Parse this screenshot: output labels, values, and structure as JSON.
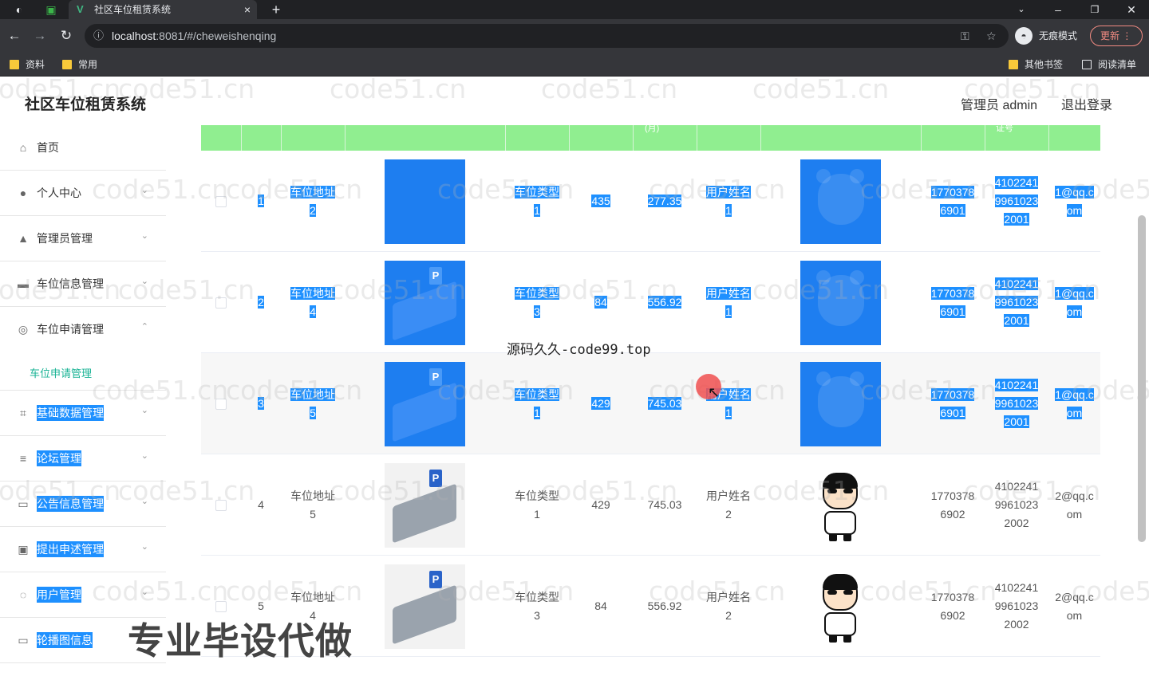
{
  "browser": {
    "tab_title": "社区车位租赁系统",
    "tab_logo": "V",
    "tab_close": "×",
    "new_tab": "+",
    "url_host": "localhost",
    "url_path": ":8081/#/cheweishenqing",
    "incognito_label": "无痕模式",
    "update_label": "更新",
    "bookmarks_left": [
      "资料",
      "常用"
    ],
    "bookmarks_right": [
      "其他书签",
      "阅读清单"
    ]
  },
  "header": {
    "title": "社区车位租赁系统",
    "admin": "管理员 admin",
    "logout": "退出登录"
  },
  "sidebar": {
    "items": [
      {
        "label": "首页",
        "icon": "home-icon",
        "glyph": "⌂",
        "arrow": ""
      },
      {
        "label": "个人中心",
        "icon": "user-icon",
        "glyph": "●",
        "arrow": "⌄"
      },
      {
        "label": "管理员管理",
        "icon": "admin-icon",
        "glyph": "▲",
        "arrow": "⌄"
      },
      {
        "label": "车位信息管理",
        "icon": "monitor-icon",
        "glyph": "▬",
        "arrow": "⌄"
      },
      {
        "label": "车位申请管理",
        "icon": "compass-icon",
        "glyph": "◎",
        "arrow": "⌃"
      },
      {
        "label": "基础数据管理",
        "icon": "crop-icon",
        "glyph": "⌗",
        "arrow": "⌄"
      },
      {
        "label": "论坛管理",
        "icon": "sliders-icon",
        "glyph": "≡",
        "arrow": "⌄"
      },
      {
        "label": "公告信息管理",
        "icon": "chat-icon",
        "glyph": "▭",
        "arrow": "⌄"
      },
      {
        "label": "提出申述管理",
        "icon": "check-icon",
        "glyph": "▣",
        "arrow": "⌄"
      },
      {
        "label": "用户管理",
        "icon": "power-icon",
        "glyph": "◌",
        "arrow": "⌄"
      },
      {
        "label": "轮播图信息",
        "icon": "message-icon",
        "glyph": "▭",
        "arrow": ""
      }
    ],
    "active_sub": "车位申请管理"
  },
  "table": {
    "header_fragments": [
      "(月)",
      "证号"
    ],
    "rows": [
      {
        "index": "1",
        "address": [
          "车位地址",
          "2"
        ],
        "type": [
          "车位类型",
          "1"
        ],
        "num": "435",
        "price": "277.35",
        "user": [
          "用户姓名",
          "1"
        ],
        "phone": [
          "1770378",
          "6901"
        ],
        "idcard": [
          "4102241",
          "9961023",
          "2001"
        ],
        "email": [
          "1@qq.c",
          "om"
        ],
        "selected": true,
        "img": "blue",
        "avatar": "bear"
      },
      {
        "index": "2",
        "address": [
          "车位地址",
          "4"
        ],
        "type": [
          "车位类型",
          "3"
        ],
        "num": "84",
        "price": "556.92",
        "user": [
          "用户姓名",
          "1"
        ],
        "phone": [
          "1770378",
          "6901"
        ],
        "idcard": [
          "4102241",
          "9961023",
          "2001"
        ],
        "email": [
          "1@qq.c",
          "om"
        ],
        "selected": true,
        "img": "blue-parking",
        "avatar": "bear"
      },
      {
        "index": "3",
        "address": [
          "车位地址",
          "5"
        ],
        "type": [
          "车位类型",
          "1"
        ],
        "num": "429",
        "price": "745.03",
        "user": [
          "用户姓名",
          "1"
        ],
        "phone": [
          "1770378",
          "6901"
        ],
        "idcard": [
          "4102241",
          "9961023",
          "2001"
        ],
        "email": [
          "1@qq.c",
          "om"
        ],
        "selected": true,
        "img": "blue-parking",
        "avatar": "bear"
      },
      {
        "index": "4",
        "address": [
          "车位地址",
          "5"
        ],
        "type": [
          "车位类型",
          "1"
        ],
        "num": "429",
        "price": "745.03",
        "user": [
          "用户姓名",
          "2"
        ],
        "phone": [
          "1770378",
          "6902"
        ],
        "idcard": [
          "4102241",
          "9961023",
          "2002"
        ],
        "email": [
          "2@qq.c",
          "om"
        ],
        "selected": false,
        "img": "parking",
        "avatar": "cartoon"
      },
      {
        "index": "5",
        "address": [
          "车位地址",
          "4"
        ],
        "type": [
          "车位类型",
          "3"
        ],
        "num": "84",
        "price": "556.92",
        "user": [
          "用户姓名",
          "2"
        ],
        "phone": [
          "1770378",
          "6902"
        ],
        "idcard": [
          "4102241",
          "9961023",
          "2002"
        ],
        "email": [
          "2@qq.c",
          "om"
        ],
        "selected": false,
        "img": "parking",
        "avatar": "cartoon"
      }
    ]
  },
  "overlays": {
    "watermark": "code51.cn",
    "center_watermark": "源码久久-code99.top",
    "promo": "专业毕设代做"
  },
  "colors": {
    "accent": "#1e90ff",
    "header_green": "#90ee90",
    "sub_active": "#19b394"
  }
}
